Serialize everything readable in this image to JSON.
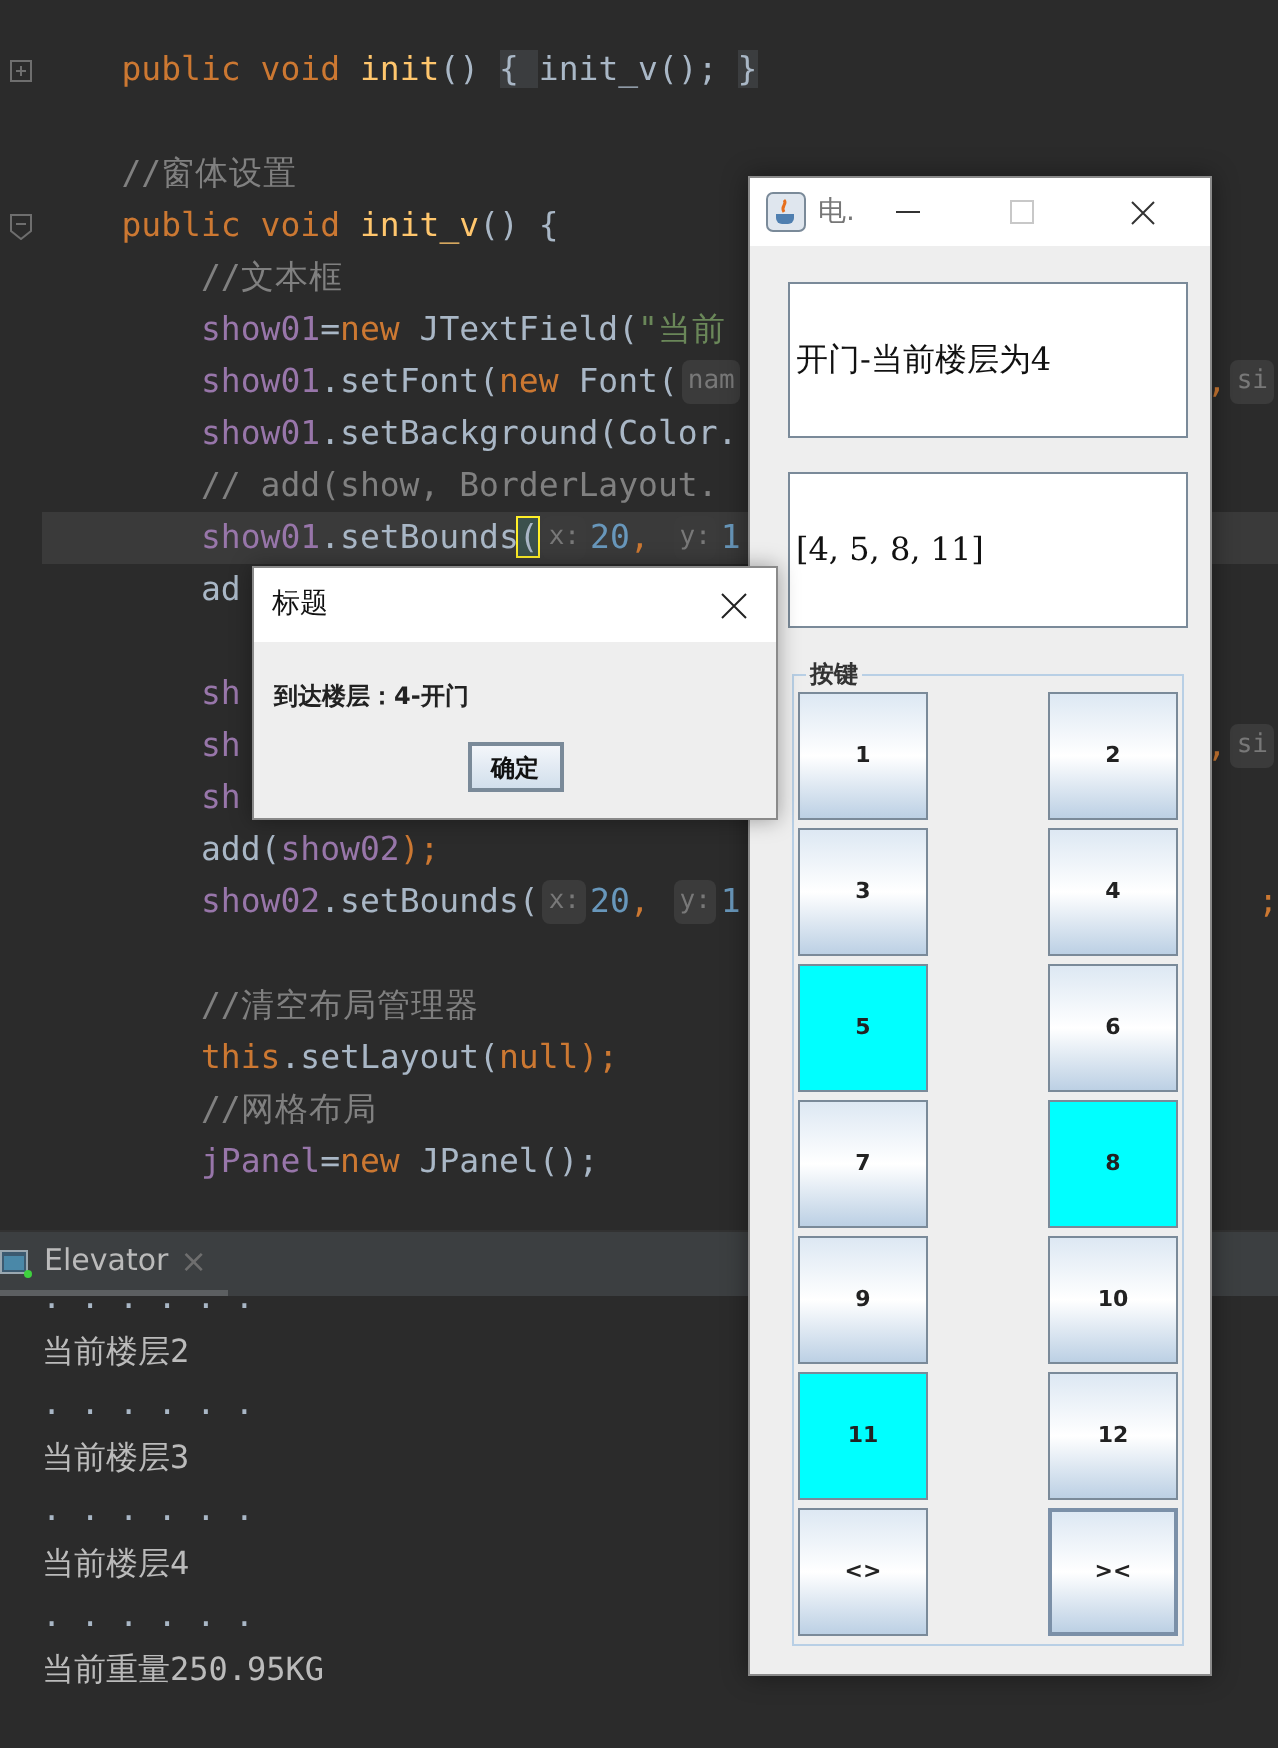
{
  "editor": {
    "lines": [
      {
        "kind": "fold_collapsed",
        "highlighted": false,
        "tokens": [
          {
            "text": "    public void ",
            "kind": "keyword"
          },
          {
            "text": "init",
            "kind": "function"
          },
          {
            "text": "() ",
            "kind": "plain"
          },
          {
            "text": "{ ",
            "kind": "folded"
          },
          {
            "text": "init_v(); ",
            "kind": "plain"
          },
          {
            "text": "}",
            "kind": "folded"
          }
        ]
      },
      {
        "kind": "plain",
        "highlighted": false
      },
      {
        "kind": "plain",
        "highlighted": false,
        "tokens": [
          {
            "text": "    //窗体设置",
            "kind": "comment"
          }
        ]
      },
      {
        "kind": "fold_expanded",
        "highlighted": false,
        "tokens": [
          {
            "text": "    public void ",
            "kind": "keyword"
          },
          {
            "text": "init_v",
            "kind": "function"
          },
          {
            "text": "() {",
            "kind": "plain"
          }
        ]
      },
      {
        "kind": "plain",
        "highlighted": false,
        "tokens": [
          {
            "text": "        //文本框",
            "kind": "comment"
          }
        ]
      },
      {
        "kind": "plain",
        "highlighted": false,
        "tokens": [
          {
            "text": "        show01",
            "kind": "field"
          },
          {
            "text": "=",
            "kind": "plain"
          },
          {
            "text": "new ",
            "kind": "keyword"
          },
          {
            "text": "JTextField(",
            "kind": "plain"
          },
          {
            "text": "\"当前",
            "kind": "string"
          }
        ]
      },
      {
        "kind": "plain",
        "highlighted": false,
        "tokens": [
          {
            "text": "        show01",
            "kind": "field"
          },
          {
            "text": ".setFont(",
            "kind": "plain"
          },
          {
            "text": "new ",
            "kind": "keyword"
          },
          {
            "text": "Font(",
            "kind": "plain"
          },
          {
            "text": "nam",
            "kind": "hint"
          }
        ],
        "right": [
          {
            "text": ",",
            "kind": "keyword"
          },
          {
            "text": "si",
            "kind": "hint"
          }
        ]
      },
      {
        "kind": "plain",
        "highlighted": false,
        "tokens": [
          {
            "text": "        show01",
            "kind": "field"
          },
          {
            "text": ".setBackground(Color.",
            "kind": "plain"
          }
        ]
      },
      {
        "kind": "plain",
        "highlighted": false,
        "tokens": [
          {
            "text": "        // add(show, BorderLayout.",
            "kind": "comment"
          }
        ]
      },
      {
        "kind": "plain",
        "highlighted": true,
        "tokens": [
          {
            "text": "        show01",
            "kind": "field"
          },
          {
            "text": ".setBounds",
            "kind": "plain"
          },
          {
            "text": "(",
            "kind": "match"
          },
          {
            "text": "x:",
            "kind": "hint"
          },
          {
            "text": "20",
            "kind": "number"
          },
          {
            "text": ", ",
            "kind": "keyword"
          },
          {
            "text": "y:",
            "kind": "hint"
          },
          {
            "text": "1",
            "kind": "number"
          }
        ]
      },
      {
        "kind": "plain",
        "highlighted": false,
        "tokens": [
          {
            "text": "        ad",
            "kind": "plain"
          }
        ]
      },
      {
        "kind": "plain",
        "highlighted": false
      },
      {
        "kind": "plain",
        "highlighted": false,
        "tokens": [
          {
            "text": "        sh",
            "kind": "field"
          }
        ]
      },
      {
        "kind": "plain",
        "highlighted": false,
        "tokens": [
          {
            "text": "        sh",
            "kind": "field"
          }
        ],
        "right": [
          {
            "text": ",",
            "kind": "keyword"
          },
          {
            "text": "si",
            "kind": "hint"
          }
        ]
      },
      {
        "kind": "plain",
        "highlighted": false,
        "tokens": [
          {
            "text": "        sh",
            "kind": "field"
          }
        ]
      },
      {
        "kind": "plain",
        "highlighted": false,
        "tokens": [
          {
            "text": "        add(",
            "kind": "plain"
          },
          {
            "text": "show02",
            "kind": "field"
          },
          {
            "text": ");",
            "kind": "keyword"
          }
        ]
      },
      {
        "kind": "plain",
        "highlighted": false,
        "tokens": [
          {
            "text": "        show02",
            "kind": "field"
          },
          {
            "text": ".setBounds(",
            "kind": "plain"
          },
          {
            "text": "x:",
            "kind": "hint"
          },
          {
            "text": "20",
            "kind": "number"
          },
          {
            "text": ", ",
            "kind": "keyword"
          },
          {
            "text": "y:",
            "kind": "hint"
          },
          {
            "text": "1",
            "kind": "number"
          }
        ],
        "right": [
          {
            "text": ";",
            "kind": "keyword"
          }
        ]
      },
      {
        "kind": "plain",
        "highlighted": false
      },
      {
        "kind": "plain",
        "highlighted": false,
        "tokens": [
          {
            "text": "        //清空布局管理器",
            "kind": "comment"
          }
        ]
      },
      {
        "kind": "plain",
        "highlighted": false,
        "tokens": [
          {
            "text": "        this",
            "kind": "keyword"
          },
          {
            "text": ".setLayout(",
            "kind": "plain"
          },
          {
            "text": "null",
            "kind": "keyword"
          },
          {
            "text": ");",
            "kind": "keyword"
          }
        ]
      },
      {
        "kind": "plain",
        "highlighted": false,
        "tokens": [
          {
            "text": "        //网格布局",
            "kind": "comment"
          }
        ]
      },
      {
        "kind": "plain",
        "highlighted": false,
        "tokens": [
          {
            "text": "        jPanel",
            "kind": "field"
          },
          {
            "text": "=",
            "kind": "plain"
          },
          {
            "text": "new ",
            "kind": "keyword"
          },
          {
            "text": "JPanel();",
            "kind": "plain"
          }
        ]
      }
    ]
  },
  "console": {
    "tab": {
      "title": "Elevator",
      "close": "×"
    },
    "lines": [
      {
        "kind": "dots",
        "text": ". . . . . ."
      },
      {
        "kind": "text",
        "text": "当前楼层2"
      },
      {
        "kind": "dots",
        "text": ". . . . . ."
      },
      {
        "kind": "text",
        "text": "当前楼层3"
      },
      {
        "kind": "dots",
        "text": ". . . . . ."
      },
      {
        "kind": "text",
        "text": "当前楼层4"
      },
      {
        "kind": "dots",
        "text": ". . . . . ."
      },
      {
        "kind": "text",
        "text": "当前重量250.95KG"
      }
    ]
  },
  "elevator_window": {
    "title": "电.",
    "status_field": "开门-当前楼层为4",
    "queue_field": "[4, 5, 8, 11]",
    "group_title": "按键",
    "buttons": [
      {
        "label": "1",
        "lit": false,
        "focused": false
      },
      {
        "label": "2",
        "lit": false,
        "focused": false
      },
      {
        "label": "3",
        "lit": false,
        "focused": false
      },
      {
        "label": "4",
        "lit": false,
        "focused": false
      },
      {
        "label": "5",
        "lit": true,
        "focused": false
      },
      {
        "label": "6",
        "lit": false,
        "focused": false
      },
      {
        "label": "7",
        "lit": false,
        "focused": false
      },
      {
        "label": "8",
        "lit": true,
        "focused": false
      },
      {
        "label": "9",
        "lit": false,
        "focused": false
      },
      {
        "label": "10",
        "lit": false,
        "focused": false
      },
      {
        "label": "11",
        "lit": true,
        "focused": false
      },
      {
        "label": "12",
        "lit": false,
        "focused": false
      },
      {
        "label": "<>",
        "lit": false,
        "focused": false
      },
      {
        "label": "><",
        "lit": false,
        "focused": true
      }
    ]
  },
  "dialog": {
    "title": "标题",
    "message": "到达楼层：4-开门",
    "ok_button": "确定"
  }
}
